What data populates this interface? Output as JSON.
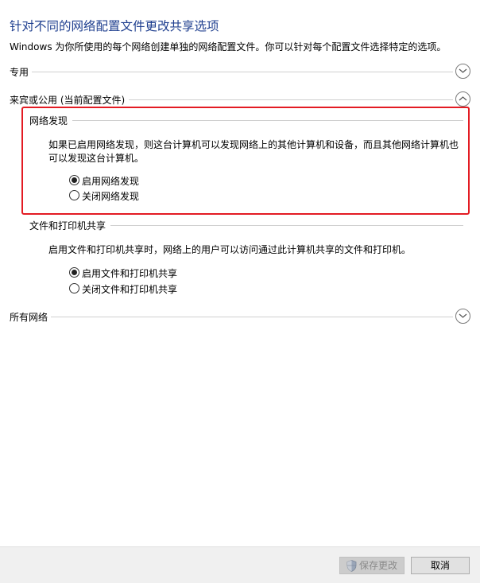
{
  "header": {
    "title": "针对不同的网络配置文件更改共享选项",
    "subtitle": "Windows 为你所使用的每个网络创建单独的网络配置文件。你可以针对每个配置文件选择特定的选项。"
  },
  "sections": {
    "private": {
      "label": "专用",
      "state": "collapsed"
    },
    "guest_public": {
      "label": "来宾或公用 (当前配置文件)",
      "state": "expanded",
      "network_discovery": {
        "label": "网络发现",
        "description": "如果已启用网络发现，则这台计算机可以发现网络上的其他计算机和设备，而且其他网络计算机也可以发现这台计算机。",
        "options": [
          {
            "label": "启用网络发现",
            "checked": true
          },
          {
            "label": "关闭网络发现",
            "checked": false
          }
        ]
      },
      "file_printer_sharing": {
        "label": "文件和打印机共享",
        "description": "启用文件和打印机共享时，网络上的用户可以访问通过此计算机共享的文件和打印机。",
        "options": [
          {
            "label": "启用文件和打印机共享",
            "checked": true
          },
          {
            "label": "关闭文件和打印机共享",
            "checked": false
          }
        ]
      }
    },
    "all_networks": {
      "label": "所有网络",
      "state": "collapsed"
    }
  },
  "footer": {
    "save_label": "保存更改",
    "cancel_label": "取消"
  },
  "colors": {
    "title": "#1f3f8f",
    "highlight_border": "#e31b23",
    "footer_bg": "#f0f0f0"
  },
  "icons": {
    "expand": "chevron-down-icon",
    "collapse": "chevron-up-icon",
    "save": "uac-shield-icon"
  }
}
